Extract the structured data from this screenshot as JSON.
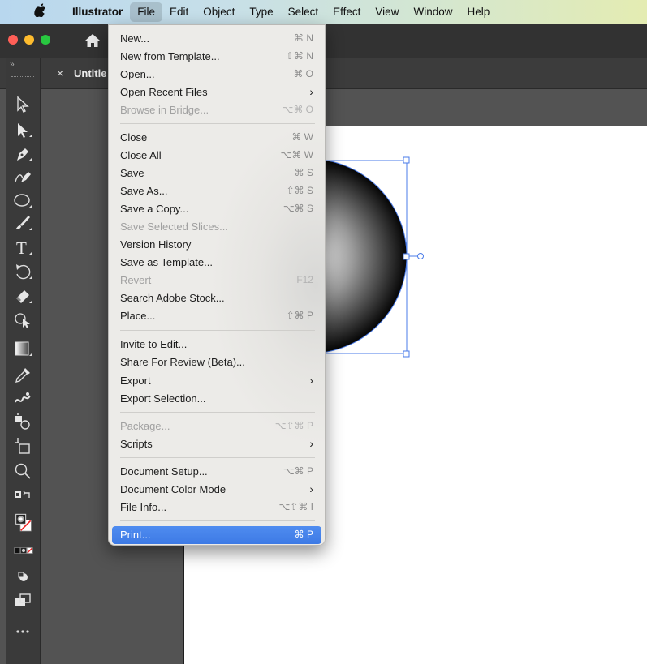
{
  "menubar": {
    "apple_icon": "apple-logo-icon",
    "items": [
      "Illustrator",
      "File",
      "Edit",
      "Object",
      "Type",
      "Select",
      "Effect",
      "View",
      "Window",
      "Help"
    ],
    "active": "File"
  },
  "titlebar": {
    "home_icon": "home-icon"
  },
  "document_tab": {
    "close_glyph": "×",
    "title": "Untitle"
  },
  "tools": [
    "selection-tool",
    "direct-selection-tool",
    "pen-tool",
    "curvature-tool",
    "ellipse-tool",
    "paintbrush-tool",
    "type-tool",
    "rotate-tool",
    "eraser-tool",
    "shape-builder-tool",
    "gradient-tool",
    "eyedropper-tool",
    "blend-tool",
    "symbol-sprayer-tool",
    "artboard-tool",
    "zoom-tool",
    "swap-fill-stroke",
    "fill-stroke-swatches",
    "color-modes",
    "draw-mode",
    "screen-mode",
    "edit-toolbar"
  ],
  "file_menu": {
    "items": [
      {
        "label": "New...",
        "shortcut": "⌘ N"
      },
      {
        "label": "New from Template...",
        "shortcut": "⇧⌘ N"
      },
      {
        "label": "Open...",
        "shortcut": "⌘ O"
      },
      {
        "label": "Open Recent Files",
        "submenu": "›"
      },
      {
        "label": "Browse in Bridge...",
        "shortcut": "⌥⌘ O",
        "disabled": true
      },
      {
        "label": "Close",
        "shortcut": "⌘ W"
      },
      {
        "label": "Close All",
        "shortcut": "⌥⌘ W"
      },
      {
        "label": "Save",
        "shortcut": "⌘ S"
      },
      {
        "label": "Save As...",
        "shortcut": "⇧⌘ S"
      },
      {
        "label": "Save a Copy...",
        "shortcut": "⌥⌘ S"
      },
      {
        "label": "Save Selected Slices...",
        "disabled": true
      },
      {
        "label": "Version History"
      },
      {
        "label": "Save as Template..."
      },
      {
        "label": "Revert",
        "shortcut": "F12",
        "disabled": true
      },
      {
        "label": "Search Adobe Stock..."
      },
      {
        "label": "Place...",
        "shortcut": "⇧⌘ P"
      },
      {
        "label": "Invite to Edit..."
      },
      {
        "label": "Share For Review (Beta)..."
      },
      {
        "label": "Export",
        "submenu": "›"
      },
      {
        "label": "Export Selection..."
      },
      {
        "label": "Package...",
        "shortcut": "⌥⇧⌘ P",
        "disabled": true
      },
      {
        "label": "Scripts",
        "submenu": "›"
      },
      {
        "label": "Document Setup...",
        "shortcut": "⌥⌘ P"
      },
      {
        "label": "Document Color Mode",
        "submenu": "›"
      },
      {
        "label": "File Info...",
        "shortcut": "⌥⇧⌘ I"
      },
      {
        "label": "Print...",
        "shortcut": "⌘ P",
        "highlighted": true
      }
    ]
  },
  "colors": {
    "highlight": "#3d7ae5",
    "canvas": "#ffffff",
    "workspace": "#535353",
    "selection": "#4a7be8"
  }
}
